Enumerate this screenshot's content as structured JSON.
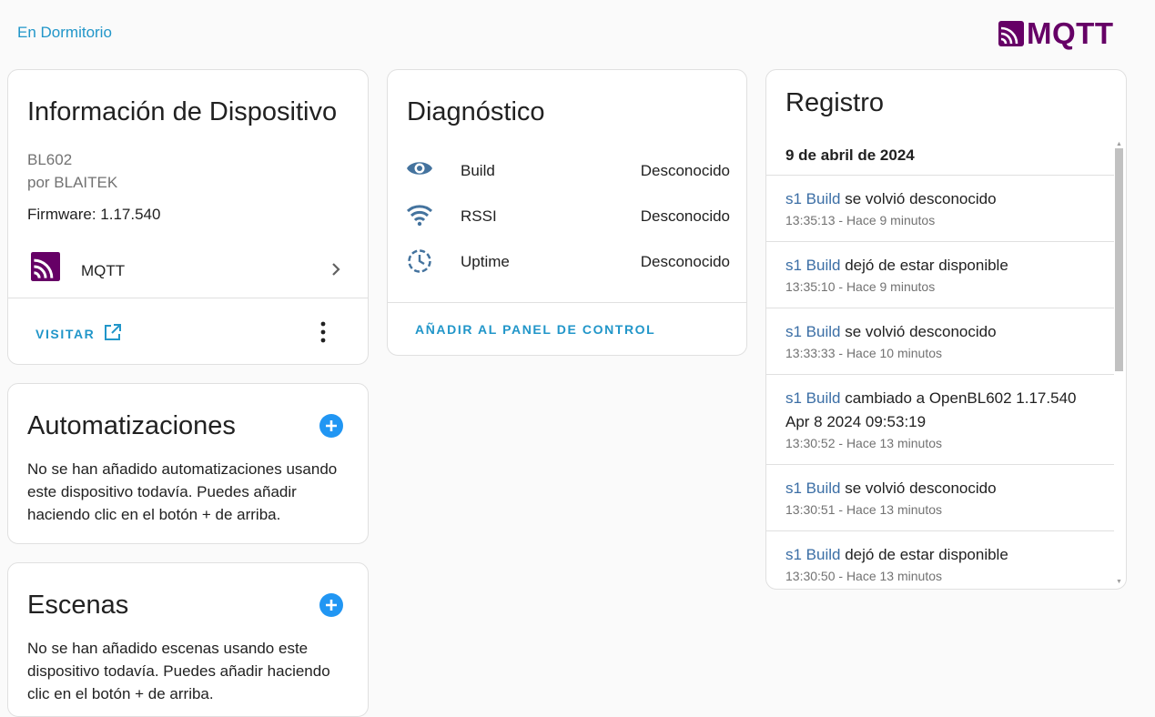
{
  "header": {
    "area_link": "En Dormitorio",
    "logo_text": "MQTT"
  },
  "device_info": {
    "title": "Información de Dispositivo",
    "model": "BL602",
    "manufacturer": "por BLAITEK",
    "firmware": "Firmware: 1.17.540",
    "integration_label": "MQTT",
    "visit_label": "VISITAR",
    "icons": {
      "integration": "mqtt-icon",
      "chevron": "chevron-right-icon",
      "visit": "open-in-new-icon",
      "menu": "dots-vertical-icon"
    }
  },
  "automations": {
    "title": "Automatizaciones",
    "description": "No se han añadido automatizaciones usando este dispositivo todavía. Puedes añadir haciendo clic en el botón + de arriba."
  },
  "scenes": {
    "title": "Escenas",
    "description": "No se han añadido escenas usando este dispositivo todavía. Puedes añadir haciendo clic en el botón + de arriba."
  },
  "diagnostics": {
    "title": "Diagnóstico",
    "rows": [
      {
        "name": "Build",
        "value": "Desconocido",
        "icon": "eye-icon"
      },
      {
        "name": "RSSI",
        "value": "Desconocido",
        "icon": "wifi-icon"
      },
      {
        "name": "Uptime",
        "value": "Desconocido",
        "icon": "clock-icon"
      }
    ],
    "add_to_dashboard_label": "AÑADIR AL PANEL DE CONTROL"
  },
  "logbook": {
    "title": "Registro",
    "date": "9 de abril de 2024",
    "entries": [
      {
        "entity": "s1 Build",
        "message": "se volvió desconocido",
        "time": "13:35:13 - Hace 9 minutos"
      },
      {
        "entity": "s1 Build",
        "message": "dejó de estar disponible",
        "time": "13:35:10 - Hace 9 minutos"
      },
      {
        "entity": "s1 Build",
        "message": "se volvió desconocido",
        "time": "13:33:33 - Hace 10 minutos"
      },
      {
        "entity": "s1 Build",
        "message": "cambiado a OpenBL602 1.17.540 Apr 8 2024 09:53:19",
        "time": "13:30:52 - Hace 13 minutos"
      },
      {
        "entity": "s1 Build",
        "message": "se volvió desconocido",
        "time": "13:30:51 - Hace 13 minutos"
      },
      {
        "entity": "s1 Build",
        "message": "dejó de estar disponible",
        "time": "13:30:50 - Hace 13 minutos"
      }
    ]
  },
  "colors": {
    "accent": "#2196c9",
    "mqtt_brand": "#660066",
    "entity_link": "#3b6ea5",
    "diag_icon": "#44739e"
  }
}
